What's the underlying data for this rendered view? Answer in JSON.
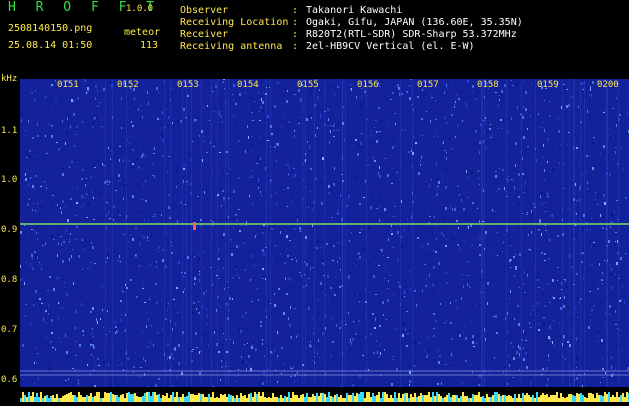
{
  "app": {
    "name": "H R O F F T",
    "version": "1.0.0"
  },
  "file": {
    "name": "2508140150.png",
    "timestamp": "25.08.14 01:50"
  },
  "detector": {
    "label": "meteor",
    "count": "113"
  },
  "metadata": [
    {
      "label": "Observer",
      "value": "Takanori Kawachi"
    },
    {
      "label": "Receiving Location",
      "value": "Ogaki, Gifu, JAPAN (136.60E, 35.35N)"
    },
    {
      "label": "Receiver",
      "value": "R820T2(RTL-SDR) SDR-Sharp 53.372MHz"
    },
    {
      "label": "Receiving antenna",
      "value": "2el-HB9CV Vertical (el. E-W)"
    }
  ],
  "axis": {
    "unit": "kHz",
    "y_ticks": [
      "1.1",
      "1.0",
      "0.9",
      "0.8",
      "0.7",
      "0.6"
    ],
    "x_ticks": [
      "0151",
      "0152",
      "0153",
      "0154",
      "0155",
      "0156",
      "0157",
      "0158",
      "0159",
      "0200"
    ]
  },
  "colors": {
    "background": "#13219a",
    "trace": "#7ddc6a",
    "label": "#ffe94a",
    "title": "#2fe03a"
  }
}
